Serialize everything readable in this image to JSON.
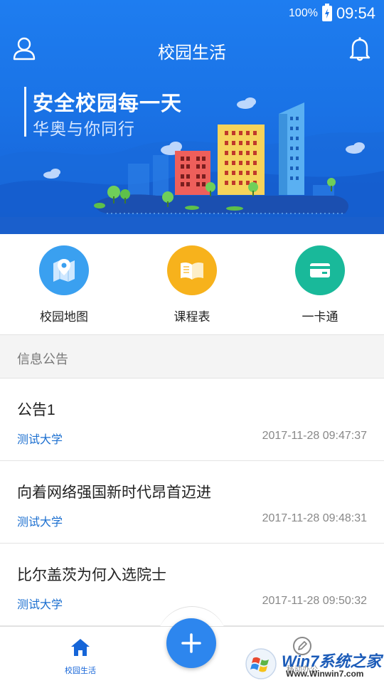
{
  "status_bar": {
    "battery_percent": "100%",
    "time": "09:54"
  },
  "header": {
    "title": "校园生活",
    "user_icon": "user-icon",
    "bell_icon": "bell-icon"
  },
  "banner": {
    "headline": "安全校园每一天",
    "subtitle": "华奥与你同行"
  },
  "quick_actions": [
    {
      "label": "校园地图",
      "icon": "map-pin-icon",
      "color": "#3aa0f0"
    },
    {
      "label": "课程表",
      "icon": "open-book-icon",
      "color": "#f7b21c"
    },
    {
      "label": "一卡通",
      "icon": "card-icon",
      "color": "#19b99a"
    }
  ],
  "notices": {
    "section_title": "信息公告",
    "items": [
      {
        "title": "公告1",
        "source": "测试大学",
        "time": "2017-11-28 09:47:37"
      },
      {
        "title": "向着网络强国新时代昂首迈进",
        "source": "测试大学",
        "time": "2017-11-28 09:48:31"
      },
      {
        "title": "比尔盖茨为何入选院士",
        "source": "测试大学",
        "time": "2017-11-28 09:50:32"
      }
    ]
  },
  "bottom_nav": {
    "home_label": "校园生活",
    "center_icon": "plus-icon",
    "right_label": "移动办公"
  },
  "watermark": {
    "brand": "Win7系统之家",
    "url": "Www.Winwin7.com"
  },
  "colors": {
    "accent": "#1a73e6",
    "link": "#1b6fd0",
    "fab": "#2d86ee"
  }
}
